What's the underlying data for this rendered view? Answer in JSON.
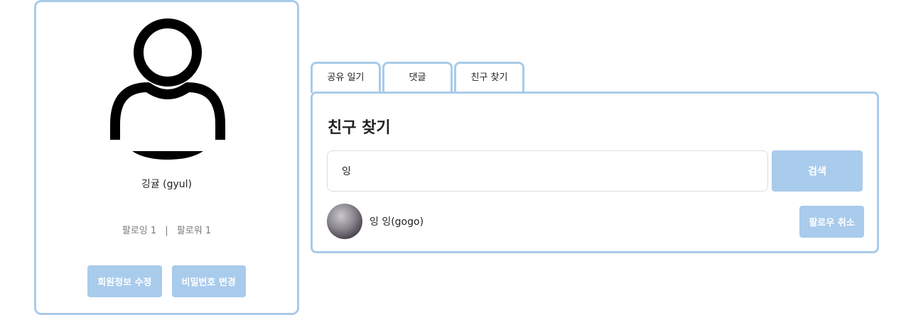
{
  "profile": {
    "avatar_icon": "user-silhouette-icon",
    "name": "깅귤 (gyul)",
    "following_label": "팔로잉 1",
    "separator": "|",
    "follower_label": "팔로워 1",
    "edit_profile_label": "회원정보 수정",
    "change_password_label": "비밀번호 변경"
  },
  "tabs": [
    {
      "label": "공유 일기"
    },
    {
      "label": "댓글"
    },
    {
      "label": "친구 찾기"
    }
  ],
  "friend_search": {
    "title": "친구 찾기",
    "query": "잉",
    "search_button_label": "검색",
    "results": [
      {
        "name": "잉 잉(gogo)",
        "action_label": "팔로우 취소"
      }
    ]
  },
  "colors": {
    "accent": "#a9cbec",
    "border": "#a9cbe9"
  }
}
